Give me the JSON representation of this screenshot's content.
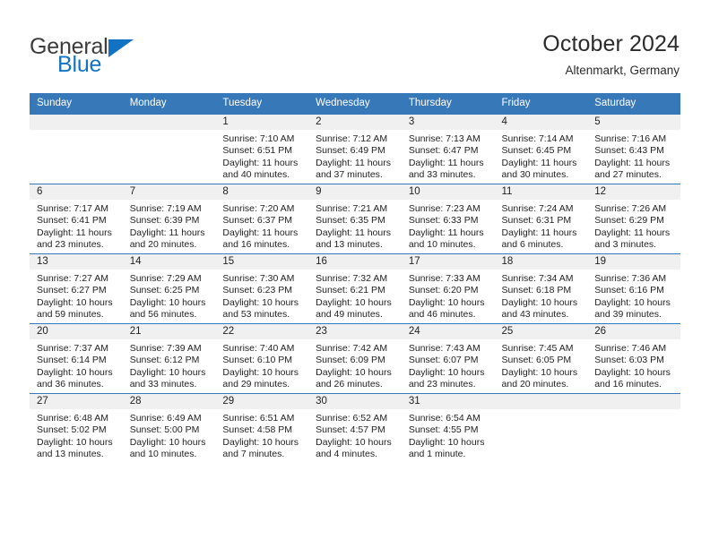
{
  "brand": {
    "word1": "General",
    "word2": "Blue",
    "triangle_color": "#1273c4"
  },
  "header": {
    "title": "October 2024",
    "subtitle": "Altenmarkt, Germany"
  },
  "colors": {
    "header_blue": "#3778b9",
    "daynum_band": "#f0f0f0",
    "text": "#1f1f1f"
  },
  "calendar": {
    "weekday_headers": [
      "Sunday",
      "Monday",
      "Tuesday",
      "Wednesday",
      "Thursday",
      "Friday",
      "Saturday"
    ],
    "weeks": [
      [
        {
          "day": "",
          "lines": []
        },
        {
          "day": "",
          "lines": []
        },
        {
          "day": "1",
          "lines": [
            "Sunrise: 7:10 AM",
            "Sunset: 6:51 PM",
            "Daylight: 11 hours",
            "and 40 minutes."
          ]
        },
        {
          "day": "2",
          "lines": [
            "Sunrise: 7:12 AM",
            "Sunset: 6:49 PM",
            "Daylight: 11 hours",
            "and 37 minutes."
          ]
        },
        {
          "day": "3",
          "lines": [
            "Sunrise: 7:13 AM",
            "Sunset: 6:47 PM",
            "Daylight: 11 hours",
            "and 33 minutes."
          ]
        },
        {
          "day": "4",
          "lines": [
            "Sunrise: 7:14 AM",
            "Sunset: 6:45 PM",
            "Daylight: 11 hours",
            "and 30 minutes."
          ]
        },
        {
          "day": "5",
          "lines": [
            "Sunrise: 7:16 AM",
            "Sunset: 6:43 PM",
            "Daylight: 11 hours",
            "and 27 minutes."
          ]
        }
      ],
      [
        {
          "day": "6",
          "lines": [
            "Sunrise: 7:17 AM",
            "Sunset: 6:41 PM",
            "Daylight: 11 hours",
            "and 23 minutes."
          ]
        },
        {
          "day": "7",
          "lines": [
            "Sunrise: 7:19 AM",
            "Sunset: 6:39 PM",
            "Daylight: 11 hours",
            "and 20 minutes."
          ]
        },
        {
          "day": "8",
          "lines": [
            "Sunrise: 7:20 AM",
            "Sunset: 6:37 PM",
            "Daylight: 11 hours",
            "and 16 minutes."
          ]
        },
        {
          "day": "9",
          "lines": [
            "Sunrise: 7:21 AM",
            "Sunset: 6:35 PM",
            "Daylight: 11 hours",
            "and 13 minutes."
          ]
        },
        {
          "day": "10",
          "lines": [
            "Sunrise: 7:23 AM",
            "Sunset: 6:33 PM",
            "Daylight: 11 hours",
            "and 10 minutes."
          ]
        },
        {
          "day": "11",
          "lines": [
            "Sunrise: 7:24 AM",
            "Sunset: 6:31 PM",
            "Daylight: 11 hours",
            "and 6 minutes."
          ]
        },
        {
          "day": "12",
          "lines": [
            "Sunrise: 7:26 AM",
            "Sunset: 6:29 PM",
            "Daylight: 11 hours",
            "and 3 minutes."
          ]
        }
      ],
      [
        {
          "day": "13",
          "lines": [
            "Sunrise: 7:27 AM",
            "Sunset: 6:27 PM",
            "Daylight: 10 hours",
            "and 59 minutes."
          ]
        },
        {
          "day": "14",
          "lines": [
            "Sunrise: 7:29 AM",
            "Sunset: 6:25 PM",
            "Daylight: 10 hours",
            "and 56 minutes."
          ]
        },
        {
          "day": "15",
          "lines": [
            "Sunrise: 7:30 AM",
            "Sunset: 6:23 PM",
            "Daylight: 10 hours",
            "and 53 minutes."
          ]
        },
        {
          "day": "16",
          "lines": [
            "Sunrise: 7:32 AM",
            "Sunset: 6:21 PM",
            "Daylight: 10 hours",
            "and 49 minutes."
          ]
        },
        {
          "day": "17",
          "lines": [
            "Sunrise: 7:33 AM",
            "Sunset: 6:20 PM",
            "Daylight: 10 hours",
            "and 46 minutes."
          ]
        },
        {
          "day": "18",
          "lines": [
            "Sunrise: 7:34 AM",
            "Sunset: 6:18 PM",
            "Daylight: 10 hours",
            "and 43 minutes."
          ]
        },
        {
          "day": "19",
          "lines": [
            "Sunrise: 7:36 AM",
            "Sunset: 6:16 PM",
            "Daylight: 10 hours",
            "and 39 minutes."
          ]
        }
      ],
      [
        {
          "day": "20",
          "lines": [
            "Sunrise: 7:37 AM",
            "Sunset: 6:14 PM",
            "Daylight: 10 hours",
            "and 36 minutes."
          ]
        },
        {
          "day": "21",
          "lines": [
            "Sunrise: 7:39 AM",
            "Sunset: 6:12 PM",
            "Daylight: 10 hours",
            "and 33 minutes."
          ]
        },
        {
          "day": "22",
          "lines": [
            "Sunrise: 7:40 AM",
            "Sunset: 6:10 PM",
            "Daylight: 10 hours",
            "and 29 minutes."
          ]
        },
        {
          "day": "23",
          "lines": [
            "Sunrise: 7:42 AM",
            "Sunset: 6:09 PM",
            "Daylight: 10 hours",
            "and 26 minutes."
          ]
        },
        {
          "day": "24",
          "lines": [
            "Sunrise: 7:43 AM",
            "Sunset: 6:07 PM",
            "Daylight: 10 hours",
            "and 23 minutes."
          ]
        },
        {
          "day": "25",
          "lines": [
            "Sunrise: 7:45 AM",
            "Sunset: 6:05 PM",
            "Daylight: 10 hours",
            "and 20 minutes."
          ]
        },
        {
          "day": "26",
          "lines": [
            "Sunrise: 7:46 AM",
            "Sunset: 6:03 PM",
            "Daylight: 10 hours",
            "and 16 minutes."
          ]
        }
      ],
      [
        {
          "day": "27",
          "lines": [
            "Sunrise: 6:48 AM",
            "Sunset: 5:02 PM",
            "Daylight: 10 hours",
            "and 13 minutes."
          ]
        },
        {
          "day": "28",
          "lines": [
            "Sunrise: 6:49 AM",
            "Sunset: 5:00 PM",
            "Daylight: 10 hours",
            "and 10 minutes."
          ]
        },
        {
          "day": "29",
          "lines": [
            "Sunrise: 6:51 AM",
            "Sunset: 4:58 PM",
            "Daylight: 10 hours",
            "and 7 minutes."
          ]
        },
        {
          "day": "30",
          "lines": [
            "Sunrise: 6:52 AM",
            "Sunset: 4:57 PM",
            "Daylight: 10 hours",
            "and 4 minutes."
          ]
        },
        {
          "day": "31",
          "lines": [
            "Sunrise: 6:54 AM",
            "Sunset: 4:55 PM",
            "Daylight: 10 hours",
            "and 1 minute."
          ]
        },
        {
          "day": "",
          "lines": []
        },
        {
          "day": "",
          "lines": []
        }
      ]
    ]
  }
}
